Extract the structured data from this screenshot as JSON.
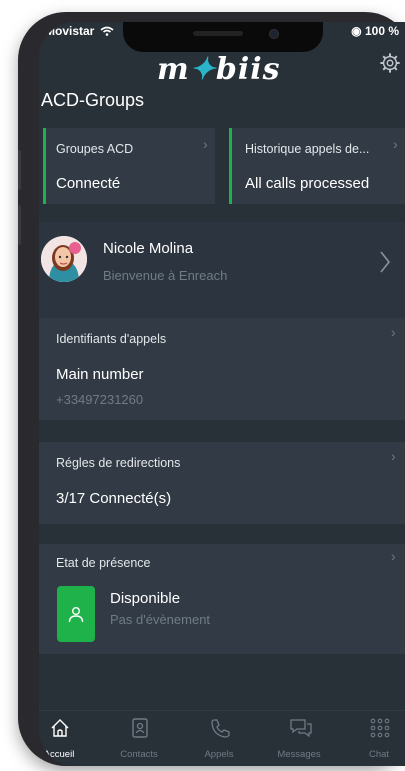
{
  "status_bar": {
    "carrier": "Movistar",
    "battery": "100 %"
  },
  "app": {
    "logo_text_1": "m",
    "logo_text_2": "biis"
  },
  "page": {
    "title": "ACD-Groups"
  },
  "acd_cards": [
    {
      "title": "Groupes ACD",
      "value": "Connecté"
    },
    {
      "title": "Historique appels de...",
      "value": "All calls processed"
    }
  ],
  "profile": {
    "name": "Nicole Molina",
    "subtitle": "Bienvenue à Enreach"
  },
  "caller_ids": {
    "title": "Identifiants d'appels",
    "value": "Main number",
    "number": "+33497231260"
  },
  "forwarding": {
    "title": "Régles de redirections",
    "value": "3/17 Connecté(s)"
  },
  "presence": {
    "title": "Etat de présence",
    "status": "Disponible",
    "detail": "Pas d'évènement"
  },
  "tabs": [
    {
      "label": "Accueil",
      "icon": "home-icon",
      "active": true
    },
    {
      "label": "Contacts",
      "icon": "contacts-icon",
      "active": false
    },
    {
      "label": "Appels",
      "icon": "phone-icon",
      "active": false
    },
    {
      "label": "Messages",
      "icon": "messages-icon",
      "active": false
    },
    {
      "label": "Chat",
      "icon": "grid-icon",
      "active": false
    }
  ],
  "colors": {
    "accent": "#1fb24a",
    "background": "#283038",
    "card": "#323b45",
    "logo_dot": "#2ab5c8"
  }
}
